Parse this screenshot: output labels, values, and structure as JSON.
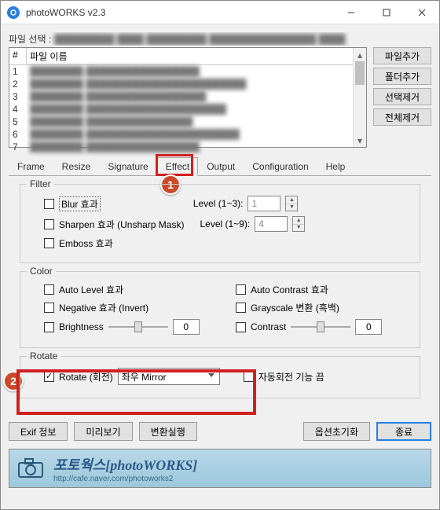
{
  "window_title": "photoWORKS v2.3",
  "file_select_label": "파일 선택 :",
  "file_select_value": "█████████ ████ █████████ ████████████████ ████",
  "file_list": {
    "col_num": "#",
    "col_name": "파일 이름",
    "rows": [
      {
        "n": "1",
        "name": "████████ █████████████████"
      },
      {
        "n": "2",
        "name": "████████ ████████████████████████"
      },
      {
        "n": "3",
        "name": "████████ ██████████████████"
      },
      {
        "n": "4",
        "name": "████████ █████████████████████"
      },
      {
        "n": "5",
        "name": "████████ ████████████████"
      },
      {
        "n": "6",
        "name": "████████ ███████████████████████"
      },
      {
        "n": "7",
        "name": "████████ █████████████████"
      }
    ]
  },
  "side_buttons": {
    "add_file": "파일추가",
    "add_folder": "폴더추가",
    "remove_sel": "선택제거",
    "remove_all": "전체제거"
  },
  "tabs": {
    "frame": "Frame",
    "resize": "Resize",
    "signature": "Signature",
    "effect": "Effect",
    "output": "Output",
    "configuration": "Configuration",
    "help": "Help"
  },
  "filter": {
    "title": "Filter",
    "blur": "Blur 효과",
    "sharpen": "Sharpen 효과 (Unsharp Mask)",
    "emboss": "Emboss 효과",
    "level13": "Level (1~3):",
    "level19": "Level (1~9):",
    "val1": "1",
    "val4": "4"
  },
  "color": {
    "title": "Color",
    "auto_level": "Auto Level 효과",
    "negative": "Negative 효과 (Invert)",
    "brightness": "Brightness",
    "auto_contrast": "Auto Contrast 효과",
    "grayscale": "Grayscale 변환 (흑백)",
    "contrast": "Contrast",
    "bval": "0",
    "cval": "0"
  },
  "rotate": {
    "title": "Rotate",
    "rotate_cb": "Rotate (회전)",
    "rotate_sel": "좌우 Mirror",
    "auto_rotate": "자동회전 기능 끔"
  },
  "bottom": {
    "exif": "Exif 정보",
    "preview": "미리보기",
    "execute": "변환실행",
    "reset": "옵션초기화",
    "close": "종료"
  },
  "banner": {
    "title": "포토웍스[photoWORKS]",
    "url": "http://cafe.naver.com/photoworks2"
  },
  "badges": {
    "one": "1",
    "two": "2"
  }
}
